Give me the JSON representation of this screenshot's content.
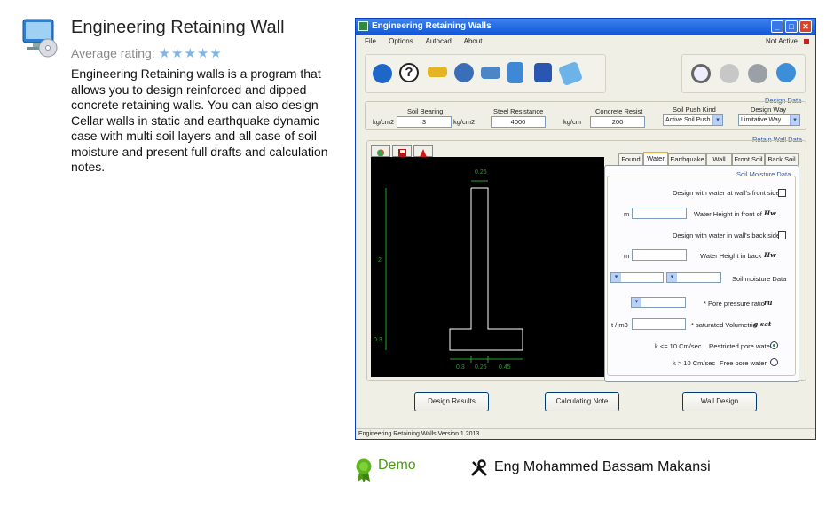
{
  "app": {
    "title": "Engineering Retaining Wall",
    "rating_label": "Average rating:",
    "stars": "★★★★★",
    "description": "Engineering Retaining walls is a program that allows you to design reinforced and dipped concrete retaining walls. You can also design Cellar walls in static and earthquake dynamic case with multi soil layers and all case of soil moisture and present full drafts and calculation notes."
  },
  "window": {
    "title": "Engineering Retaining Walls",
    "menu": [
      "File",
      "Options",
      "Autocad",
      "About"
    ],
    "not_active": "Not Active",
    "status": "Engineering Retaining Walls Version 1.2013"
  },
  "design_data": {
    "title": "Design Data",
    "soil_bearing": {
      "label": "Soil Bearing",
      "unit": "kg/cm2",
      "value": "3"
    },
    "steel_resistance": {
      "label": "Steel Resistance",
      "unit": "kg/cm2",
      "value": "4000"
    },
    "concrete_resist": {
      "label": "Concrete Resist",
      "unit": "kg/cm",
      "value": "200"
    },
    "soil_push_kind": {
      "label": "Soil Push Kind",
      "value": "Active Soil Push"
    },
    "design_way": {
      "label": "Design Way",
      "value": "Limitative Way"
    }
  },
  "retain_wall_data": {
    "title": "Retain Wall Data",
    "dimensions": {
      "top": "0.25",
      "height": "2",
      "base": "0.3",
      "b1": "0.3",
      "b2": "0.25",
      "b3": "0.45"
    }
  },
  "tabs": [
    "Found",
    "Water",
    "Earthquake",
    "Wall",
    "Front Soil",
    "Back Soil"
  ],
  "active_tab": "Water",
  "soil_moisture": {
    "title": "Soil Moisture Data",
    "front_water_label": "Design with water at wall's front side",
    "unit_m": "m",
    "front_height_label": "Water Height in front of",
    "hw_symbol": "Hw",
    "back_water_label": "Design with water in wall's back side",
    "back_height_label": "Water Height in back",
    "soil_moisture_label": "Soil moisture Data",
    "pore_label": "* Pore pressure ratio",
    "ru_symbol": "ru",
    "unit_tm3": "t / m3",
    "sat_label": "* saturated Volumetric",
    "gsat_symbol": "g sat",
    "k_small": "k <= 10 Cm/sec",
    "restricted": "Restricted pore water",
    "k_large": "k > 10 Cm/sec",
    "free": "Free pore water"
  },
  "buttons": {
    "design_results": "Design Results",
    "calculating_note": "Calculating Note",
    "wall_design": "Wall Design"
  },
  "footer": {
    "demo": "Demo",
    "author": "Eng Mohammed Bassam Makansi"
  }
}
